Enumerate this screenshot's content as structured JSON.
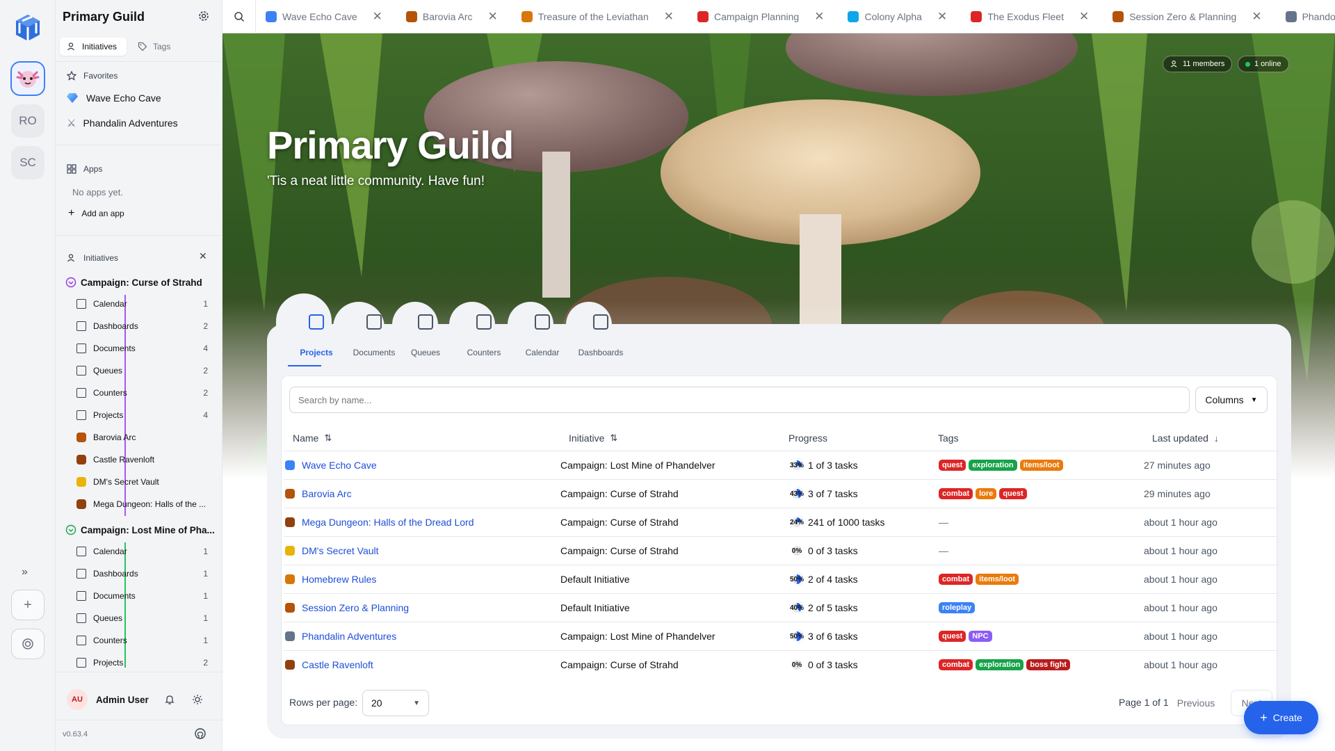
{
  "colors": {
    "accent": "#2563eb",
    "tag_red": "#dc2626",
    "tag_green": "#16a34a",
    "tag_orange": "#ea7a0c",
    "tag_blue": "#3b82f6",
    "tag_purple": "#8b5cf6",
    "tag_darkred": "#b91c1c"
  },
  "rail": {
    "items": [
      {
        "label": "RO"
      },
      {
        "label": "SC"
      }
    ]
  },
  "sidebar": {
    "title": "Primary Guild",
    "tabs": {
      "initiatives": "Initiatives",
      "tags": "Tags"
    },
    "favorites_label": "Favorites",
    "favorites": [
      {
        "label": "Wave Echo Cave",
        "icon": "gem-icon"
      },
      {
        "label": "Phandalin Adventures",
        "icon": "swords-icon"
      }
    ],
    "apps_label": "Apps",
    "no_apps": "No apps yet.",
    "add_app": "Add an app",
    "initiatives_label": "Initiatives",
    "groups": [
      {
        "name": "Campaign: Curse of Strahd",
        "items": [
          {
            "label": "Calendar",
            "count": "1"
          },
          {
            "label": "Dashboards",
            "count": "2"
          },
          {
            "label": "Documents",
            "count": "4"
          },
          {
            "label": "Queues",
            "count": "2"
          },
          {
            "label": "Counters",
            "count": "2"
          },
          {
            "label": "Projects",
            "count": "4"
          }
        ],
        "projects": [
          "Barovia Arc",
          "Castle Ravenloft",
          "DM's Secret Vault",
          "Mega Dungeon: Halls of the ..."
        ]
      },
      {
        "name": "Campaign: Lost Mine of Pha...",
        "items": [
          {
            "label": "Calendar",
            "count": "1"
          },
          {
            "label": "Dashboards",
            "count": "1"
          },
          {
            "label": "Documents",
            "count": "1"
          },
          {
            "label": "Queues",
            "count": "1"
          },
          {
            "label": "Counters",
            "count": "1"
          },
          {
            "label": "Projects",
            "count": "2"
          }
        ]
      }
    ],
    "user": {
      "initials": "AU",
      "name": "Admin User"
    },
    "version": "v0.63.4"
  },
  "tabs": [
    {
      "label": "Wave Echo Cave",
      "icon": "gem-icon"
    },
    {
      "label": "Barovia Arc",
      "icon": "vampire-icon"
    },
    {
      "label": "Treasure of the Leviathan",
      "icon": "moneybag-icon"
    },
    {
      "label": "Campaign Planning",
      "icon": "calendar-icon"
    },
    {
      "label": "Colony Alpha",
      "icon": "globe-icon"
    },
    {
      "label": "The Exodus Fleet",
      "icon": "rocket-icon"
    },
    {
      "label": "Session Zero & Planning",
      "icon": "clipboard-icon"
    },
    {
      "label": "Phando",
      "icon": "swords-icon"
    }
  ],
  "hero": {
    "title": "Primary Guild",
    "subtitle": "'Tis a neat little community. Have fun!",
    "members": "11 members",
    "online": "1 online"
  },
  "views": [
    {
      "label": "Projects"
    },
    {
      "label": "Documents"
    },
    {
      "label": "Queues"
    },
    {
      "label": "Counters"
    },
    {
      "label": "Calendar"
    },
    {
      "label": "Dashboards"
    }
  ],
  "table": {
    "search_placeholder": "Search by name...",
    "columns_button": "Columns",
    "headers": {
      "name": "Name",
      "initiative": "Initiative",
      "progress": "Progress",
      "tags": "Tags",
      "updated": "Last updated"
    },
    "rows": [
      {
        "name": "Wave Echo Cave",
        "icon": "gem-icon",
        "initiative": "Campaign: Lost Mine of Phandelver",
        "pct": "33%",
        "tasks": "1 of 3 tasks",
        "tags": [
          [
            "quest",
            "red"
          ],
          [
            "exploration",
            "green"
          ],
          [
            "items/loot",
            "orange"
          ]
        ],
        "updated": "27 minutes ago"
      },
      {
        "name": "Barovia Arc",
        "icon": "vampire-icon",
        "initiative": "Campaign: Curse of Strahd",
        "pct": "43%",
        "tasks": "3 of 7 tasks",
        "tags": [
          [
            "combat",
            "red"
          ],
          [
            "lore",
            "orange"
          ],
          [
            "quest",
            "red"
          ]
        ],
        "updated": "29 minutes ago"
      },
      {
        "name": "Mega Dungeon: Halls of the Dread Lord",
        "icon": "castle-icon",
        "initiative": "Campaign: Curse of Strahd",
        "pct": "24%",
        "tasks": "241 of 1000 tasks",
        "tags": [],
        "updated": "about 1 hour ago"
      },
      {
        "name": "DM's Secret Vault",
        "icon": "lock-icon",
        "initiative": "Campaign: Curse of Strahd",
        "pct": "0%",
        "tasks": "0 of 3 tasks",
        "tags": [],
        "updated": "about 1 hour ago"
      },
      {
        "name": "Homebrew Rules",
        "icon": "scroll-icon",
        "initiative": "Default Initiative",
        "pct": "50%",
        "tasks": "2 of 4 tasks",
        "tags": [
          [
            "combat",
            "red"
          ],
          [
            "items/loot",
            "orange"
          ]
        ],
        "updated": "about 1 hour ago"
      },
      {
        "name": "Session Zero & Planning",
        "icon": "clipboard-icon",
        "initiative": "Default Initiative",
        "pct": "40%",
        "tasks": "2 of 5 tasks",
        "tags": [
          [
            "roleplay",
            "blue"
          ]
        ],
        "updated": "about 1 hour ago"
      },
      {
        "name": "Phandalin Adventures",
        "icon": "swords-icon",
        "initiative": "Campaign: Lost Mine of Phandelver",
        "pct": "50%",
        "tasks": "3 of 6 tasks",
        "tags": [
          [
            "quest",
            "red"
          ],
          [
            "NPC",
            "purple"
          ]
        ],
        "updated": "about 1 hour ago"
      },
      {
        "name": "Castle Ravenloft",
        "icon": "castle-icon",
        "initiative": "Campaign: Curse of Strahd",
        "pct": "0%",
        "tasks": "0 of 3 tasks",
        "tags": [
          [
            "combat",
            "red"
          ],
          [
            "exploration",
            "green"
          ],
          [
            "boss fight",
            "darkred"
          ]
        ],
        "updated": "about 1 hour ago"
      }
    ],
    "rows_per_page_label": "Rows per page:",
    "rows_per_page": "20",
    "page_info": "Page 1 of 1",
    "previous": "Previous",
    "next": "Next",
    "create": "Create",
    "empty_tag": "—"
  }
}
